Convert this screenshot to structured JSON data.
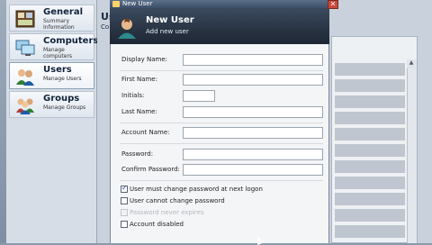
{
  "sidebar": {
    "items": [
      {
        "title": "General",
        "subtitle": "Summary Information"
      },
      {
        "title": "Computers",
        "subtitle": "Manage computers"
      },
      {
        "title": "Users",
        "subtitle": "Manage Users"
      },
      {
        "title": "Groups",
        "subtitle": "Manage Groups"
      }
    ]
  },
  "background": {
    "heading": "Us",
    "subheading": "Co"
  },
  "dialog": {
    "window_title": "New User",
    "header_title": "New User",
    "header_subtitle": "Add new user",
    "close_label": "✕",
    "fields": {
      "display_name": {
        "label": "Display Name:",
        "value": ""
      },
      "first_name": {
        "label": "First Name:",
        "value": ""
      },
      "initials": {
        "label": "Initials:",
        "value": ""
      },
      "last_name": {
        "label": "Last Name:",
        "value": ""
      },
      "account_name": {
        "label": "Account Name:",
        "value": ""
      },
      "password": {
        "label": "Password:",
        "value": ""
      },
      "confirm_password": {
        "label": "Confirm Password:",
        "value": ""
      }
    },
    "options": {
      "must_change": {
        "label": "User must change password at next logon",
        "checked": true
      },
      "cannot_change": {
        "label": "User cannot change password",
        "checked": false
      },
      "never_expires": {
        "label": "Password never expires",
        "checked": false
      },
      "disabled": {
        "label": "Account disabled",
        "checked": false
      }
    }
  },
  "icons": {
    "general": "panel-icon",
    "computers": "computer-icon",
    "users": "users-icon",
    "groups": "groups-icon",
    "new_user": "user-icon"
  },
  "colors": {
    "header_bg": "#1d2633",
    "title_bar": "#3c4f68",
    "close_button": "#c9473a"
  }
}
